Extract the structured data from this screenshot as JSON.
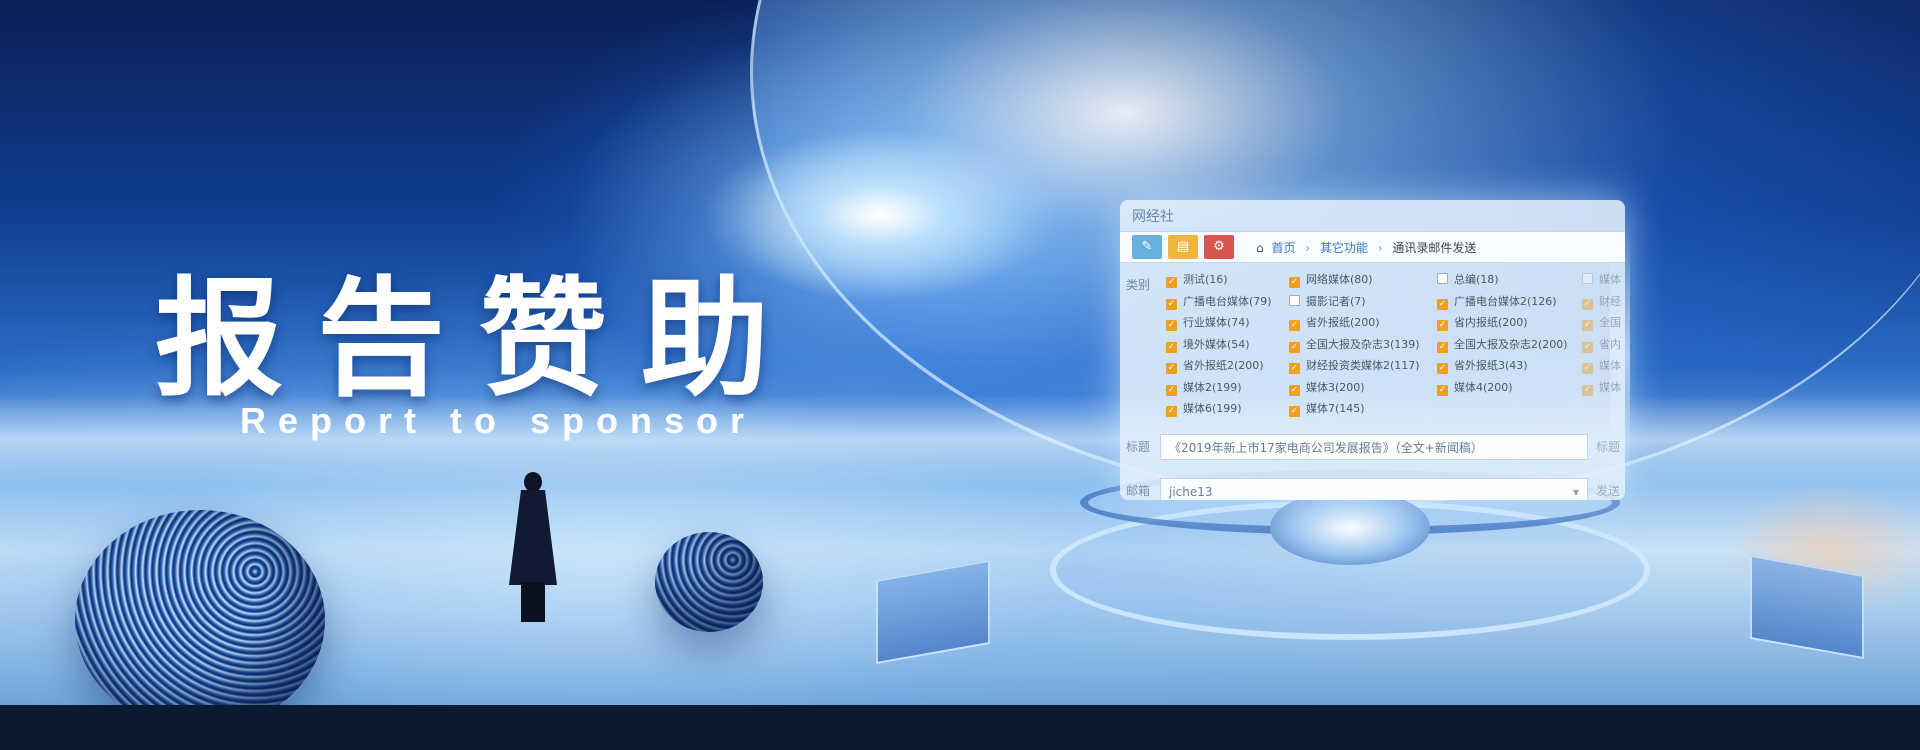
{
  "banner": {
    "title": "报告赞助",
    "subtitle": "Report to sponsor"
  },
  "window": {
    "title": "网经社",
    "toolbar": {
      "buttons": [
        {
          "icon": "edit-icon",
          "color": "#67b1dd"
        },
        {
          "icon": "document-icon",
          "color": "#f0b443"
        },
        {
          "icon": "gears-icon",
          "color": "#d9534f"
        }
      ]
    },
    "breadcrumb": {
      "home_icon": "home-icon",
      "home": "首页",
      "level2": "其它功能",
      "current": "通讯录邮件发送"
    },
    "category_label": "类别",
    "categories": [
      {
        "label": "测试(16)",
        "checked": true
      },
      {
        "label": "网络媒体(80)",
        "checked": true
      },
      {
        "label": "总编(18)",
        "checked": false
      },
      {
        "label": "媒体",
        "checked": false
      },
      {
        "label": "广播电台媒体(79)",
        "checked": true
      },
      {
        "label": "摄影记者(7)",
        "checked": false
      },
      {
        "label": "广播电台媒体2(126)",
        "checked": true
      },
      {
        "label": "财经",
        "checked": true
      },
      {
        "label": "行业媒体(74)",
        "checked": true
      },
      {
        "label": "省外报纸(200)",
        "checked": true
      },
      {
        "label": "省内报纸(200)",
        "checked": true
      },
      {
        "label": "全国",
        "checked": true
      },
      {
        "label": "境外媒体(54)",
        "checked": true
      },
      {
        "label": "全国大报及杂志3(139)",
        "checked": true
      },
      {
        "label": "全国大报及杂志2(200)",
        "checked": true
      },
      {
        "label": "省内",
        "checked": true
      },
      {
        "label": "省外报纸2(200)",
        "checked": true
      },
      {
        "label": "财经投资类媒体2(117)",
        "checked": true
      },
      {
        "label": "省外报纸3(43)",
        "checked": true
      },
      {
        "label": "媒体",
        "checked": true
      },
      {
        "label": "媒体2(199)",
        "checked": true
      },
      {
        "label": "媒体3(200)",
        "checked": true
      },
      {
        "label": "媒体4(200)",
        "checked": true
      },
      {
        "label": "媒体",
        "checked": true
      },
      {
        "label": "媒体6(199)",
        "checked": true
      },
      {
        "label": "媒体7(145)",
        "checked": true
      }
    ],
    "subject_label": "标题",
    "subject_value": "《2019年新上市17家电商公司发展报告》（全文+新闻稿）",
    "subject_side_label": "标题",
    "mailbox_label": "邮箱",
    "mailbox_value": "jiche13",
    "mailbox_side_label": "发送"
  }
}
